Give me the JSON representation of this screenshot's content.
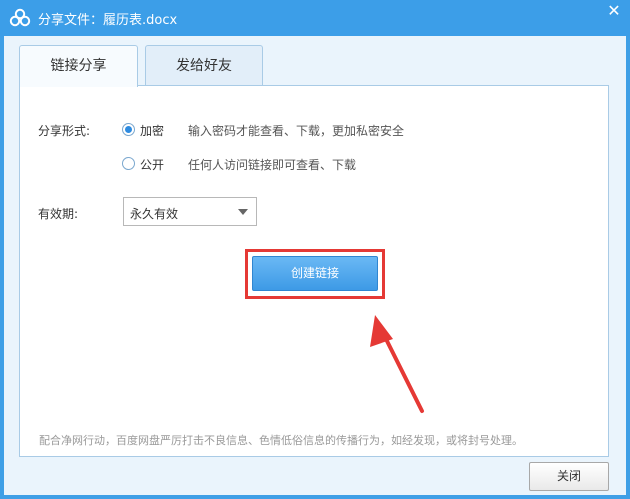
{
  "window": {
    "title": "分享文件：履历表.docx",
    "close_symbol": "✕"
  },
  "tabs": [
    {
      "label": "链接分享",
      "active": true
    },
    {
      "label": "发给好友",
      "active": false
    }
  ],
  "share_form": {
    "label": "分享形式:",
    "options": [
      {
        "label": "加密",
        "hint": "输入密码才能查看、下载，更加私密安全",
        "checked": true
      },
      {
        "label": "公开",
        "hint": "任何人访问链接即可查看、下载",
        "checked": false
      }
    ]
  },
  "validity": {
    "label": "有效期:",
    "selected": "永久有效"
  },
  "create_link_label": "创建链接",
  "footer_note": "配合净网行动，百度网盘严厉打击不良信息、色情低俗信息的传播行为，如经发现，或将封号处理。",
  "close_label": "关闭",
  "colors": {
    "titlebar": "#3c9ee8",
    "primary_button": "#3d9ae6",
    "highlight": "#e53935"
  }
}
